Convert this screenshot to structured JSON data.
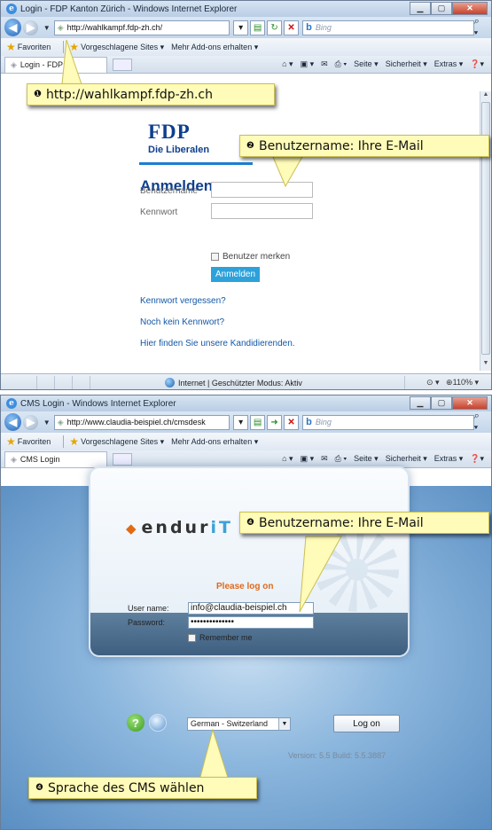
{
  "window1": {
    "title": "Login - FDP Kanton Zürich - Windows Internet Explorer",
    "address": "http://wahlkampf.fdp-zh.ch/",
    "search_placeholder": "Bing",
    "favorites_label": "Favoriten",
    "suggested_sites": "Vorgeschlagene Sites ▾",
    "addons": "Mehr Add-ons erhalten ▾",
    "tab_title": "Login - FDP",
    "cmd_page": "Seite ▾",
    "cmd_security": "Sicherheit ▾",
    "cmd_extras": "Extras ▾",
    "page": {
      "logo": "FDP",
      "logo_sub": "Die Liberalen",
      "heading": "Anmelden",
      "username_label": "Benutzername",
      "password_label": "Kennwort",
      "remember_label": "Benutzer merken",
      "login_button": "Anmelden",
      "link_forgot": "Kennwort vergessen?",
      "link_no_password": "Noch kein Kennwort?",
      "link_candidates": "Hier finden Sie unsere Kandidierenden."
    },
    "status_mode": "Internet | Geschützter Modus: Aktiv",
    "zoom": "110%"
  },
  "window2": {
    "title": "CMS Login - Windows Internet Explorer",
    "address": "http://www.claudia-beispiel.ch/cmsdesk",
    "search_placeholder": "Bing",
    "favorites_label": "Favoriten",
    "suggested_sites": "Vorgeschlagene Sites ▾",
    "addons": "Mehr Add-ons erhalten ▾",
    "tab_title": "CMS Login",
    "cmd_page": "Seite ▾",
    "cmd_security": "Sicherheit ▾",
    "cmd_extras": "Extras ▾",
    "page": {
      "logo": "endur",
      "logo_suffix": "iT",
      "please_log_on": "Please log on",
      "username_label": "User name:",
      "username_value": "info@claudia-beispiel.ch",
      "password_label": "Password:",
      "password_value": "••••••••••••••",
      "remember_label": "Remember me",
      "language_selected": "German - Switzerland",
      "logon_button": "Log on",
      "version": "Version: 5.5 Build: 5.5.3887"
    }
  },
  "callouts": {
    "c1_num": "❶",
    "c1": "http://wahlkampf.fdp-zh.ch",
    "c2_num": "❷",
    "c2": "Benutzername: Ihre E-Mail",
    "c3_num": "❹",
    "c3": "Benutzername: Ihre E-Mail",
    "c4_num": "❹",
    "c4": "Sprache des CMS wählen"
  },
  "colors": {
    "callout_bg": "#fffbb8",
    "fdp_blue": "#0e3f8d",
    "fdp_button": "#2da1da",
    "enduro_orange": "#e0691a"
  }
}
